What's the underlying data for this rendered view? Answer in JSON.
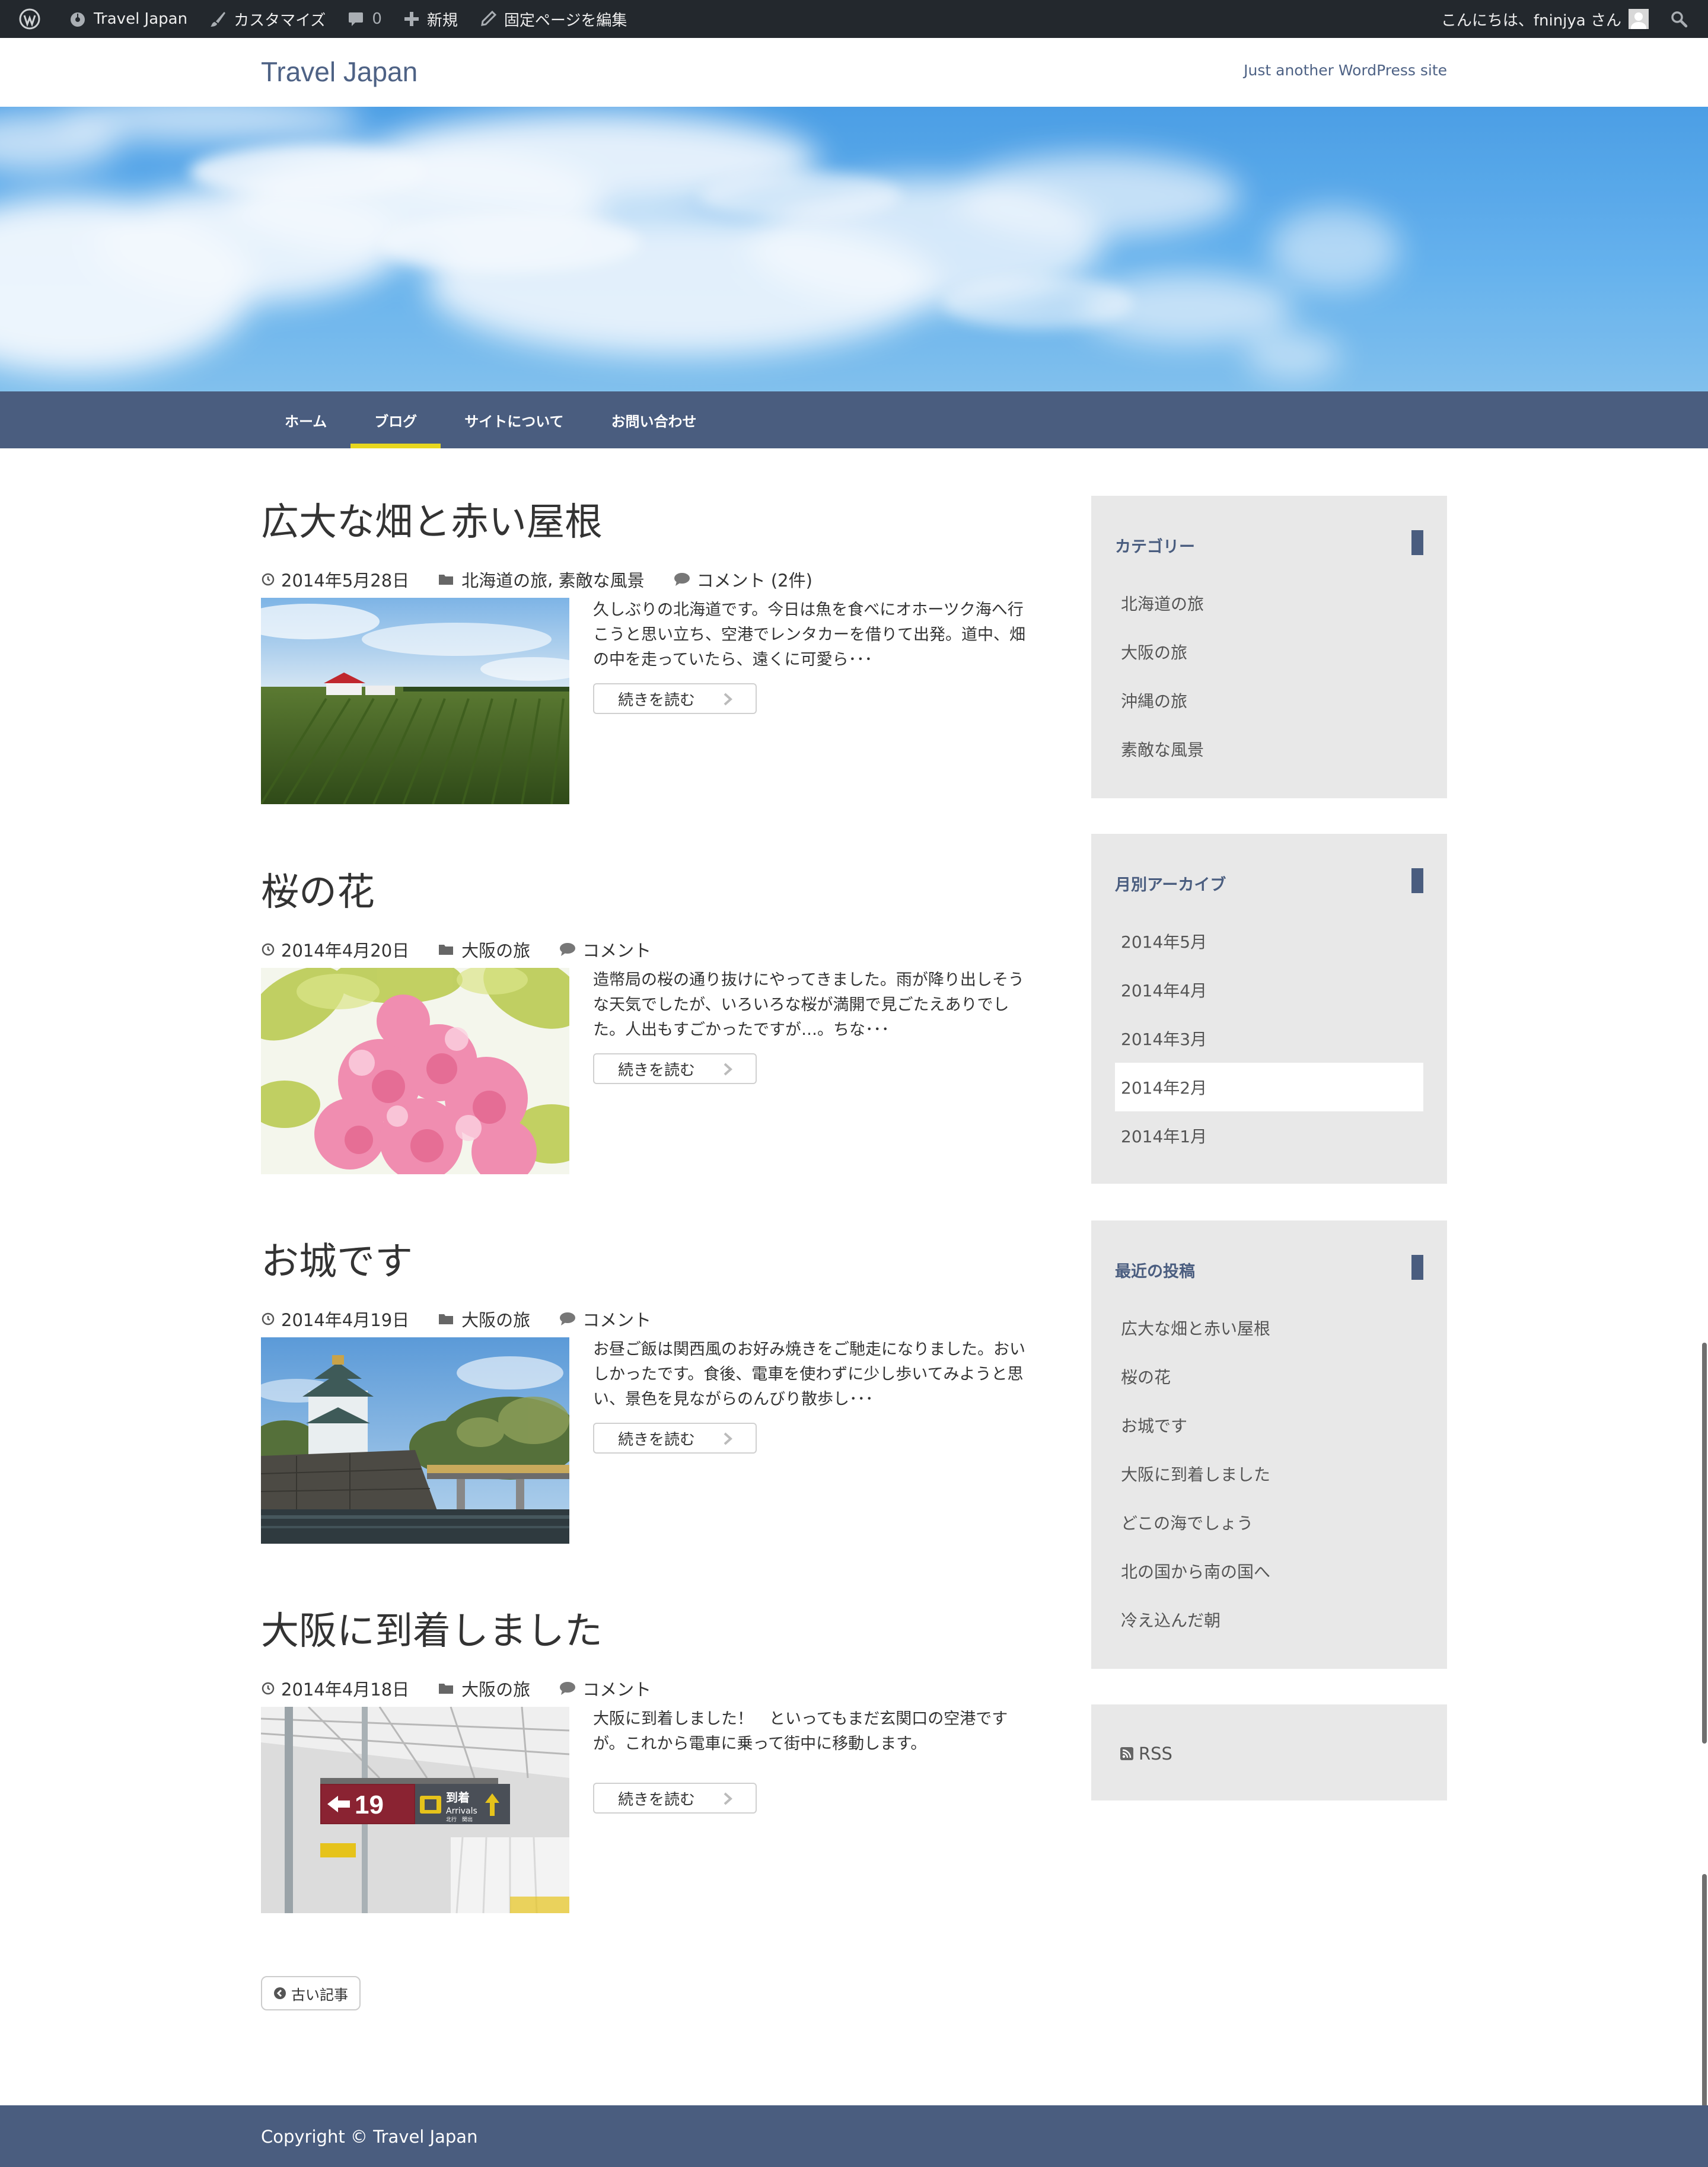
{
  "admin_bar": {
    "site_name": "Travel Japan",
    "customize": "カスタマイズ",
    "comments_count": "0",
    "new": "新規",
    "edit_page": "固定ページを編集",
    "greeting": "こんにちは、fninjya さん"
  },
  "site": {
    "title": "Travel Japan",
    "description": "Just another WordPress site"
  },
  "nav": {
    "items": [
      "ホーム",
      "ブログ",
      "サイトについて",
      "お問い合わせ"
    ],
    "active": "ブログ"
  },
  "posts": [
    {
      "title": "広大な畑と赤い屋根",
      "date": "2014年5月28日",
      "category_1": "北海道の旅",
      "category_sep": ", ",
      "category_2": "素敵な風景",
      "comments": "コメント (2件)",
      "excerpt": "久しぶりの北海道です。今日は魚を食べにオホーツク海へ行こうと思い立ち、空港でレンタカーを借りて出発。道中、畑の中を走っていたら、遠くに可愛ら･･･",
      "read_more": "続きを読む",
      "thumb": "farm-field-red-roof"
    },
    {
      "title": "桜の花",
      "date": "2014年4月20日",
      "category_1": "大阪の旅",
      "comments": "コメント",
      "excerpt": "造幣局の桜の通り抜けにやってきました。雨が降り出しそうな天気でしたが、いろいろな桜が満開で見ごたえありでした。人出もすごかったですが…。ちな･･･",
      "read_more": "続きを読む",
      "thumb": "cherry-blossoms"
    },
    {
      "title": "お城です",
      "date": "2014年4月19日",
      "category_1": "大阪の旅",
      "comments": "コメント",
      "excerpt": "お昼ご飯は関西風のお好み焼きをご馳走になりました。おいしかったです。食後、電車を使わずに少し歩いてみようと思い、景色を見ながらのんびり散歩し･･･",
      "read_more": "続きを読む",
      "thumb": "osaka-castle"
    },
    {
      "title": "大阪に到着しました",
      "date": "2014年4月18日",
      "category_1": "大阪の旅",
      "comments": "コメント",
      "excerpt": "大阪に到着しました！　といってもまだ玄関口の空港ですが。これから電車に乗って街中に移動します。",
      "read_more": "続きを読む",
      "thumb": "airport-arrivals",
      "sign": {
        "gate": "19",
        "arrivals_ja": "到着",
        "arrivals_en": "Arrivals",
        "small": "北行　関出"
      }
    }
  ],
  "older_posts": "古い記事",
  "sidebar": {
    "categories": {
      "title": "カテゴリー",
      "items": [
        "北海道の旅",
        "大阪の旅",
        "沖縄の旅",
        "素敵な風景"
      ]
    },
    "archives": {
      "title": "月別アーカイブ",
      "items": [
        "2014年5月",
        "2014年4月",
        "2014年3月",
        "2014年2月",
        "2014年1月"
      ],
      "highlighted": "2014年2月"
    },
    "recent": {
      "title": "最近の投稿",
      "items": [
        "広大な畑と赤い屋根",
        "桜の花",
        "お城です",
        "大阪に到着しました",
        "どこの海でしょう",
        "北の国から南の国へ",
        "冷え込んだ朝"
      ]
    },
    "rss": "RSS"
  },
  "footer": {
    "copyright": "Copyright © Travel Japan"
  },
  "colors": {
    "admin_bar": "#23282d",
    "brand": "#4a5d7f",
    "nav_active": "#e8d71e",
    "widget_bg": "#e8e8e8"
  }
}
